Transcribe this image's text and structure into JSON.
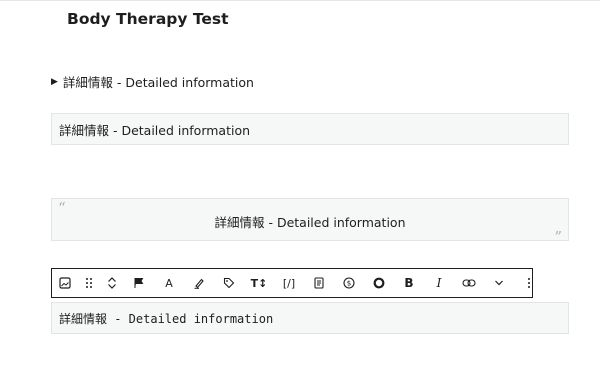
{
  "page": {
    "title": "Body Therapy Test"
  },
  "details": {
    "summary": "詳細情報 - Detailed information"
  },
  "paragraph": {
    "text": "詳細情報 - Detailed information"
  },
  "quote": {
    "text": "詳細情報 - Detailed information",
    "open_mark": "“",
    "close_mark": "”"
  },
  "preformatted": {
    "text": "詳細情報 - Detailed information"
  },
  "toolbar": {
    "buttons": [
      {
        "name": "image-block-icon",
        "glyph": ""
      },
      {
        "name": "drag-handle-icon",
        "glyph": ""
      },
      {
        "name": "move-up-down",
        "glyph": ""
      },
      {
        "name": "flag-icon",
        "glyph": ""
      },
      {
        "name": "text-color-button",
        "glyph": "A"
      },
      {
        "name": "highlight-button",
        "glyph": ""
      },
      {
        "name": "tag-button",
        "glyph": ""
      },
      {
        "name": "font-size-button",
        "glyph": "T↕"
      },
      {
        "name": "code-button",
        "glyph": "[/]"
      },
      {
        "name": "note-button",
        "glyph": ""
      },
      {
        "name": "currency-button",
        "glyph": ""
      },
      {
        "name": "circle-button",
        "glyph": ""
      },
      {
        "name": "bold-button",
        "glyph": "B"
      },
      {
        "name": "italic-button",
        "glyph": "I"
      },
      {
        "name": "link-button",
        "glyph": ""
      },
      {
        "name": "more-formats-button",
        "glyph": ""
      },
      {
        "name": "options-button",
        "glyph": ""
      }
    ]
  },
  "colors": {
    "box_bg": "#f6f7f7",
    "box_border": "#e2e4e7",
    "text": "#1e1e1e"
  }
}
